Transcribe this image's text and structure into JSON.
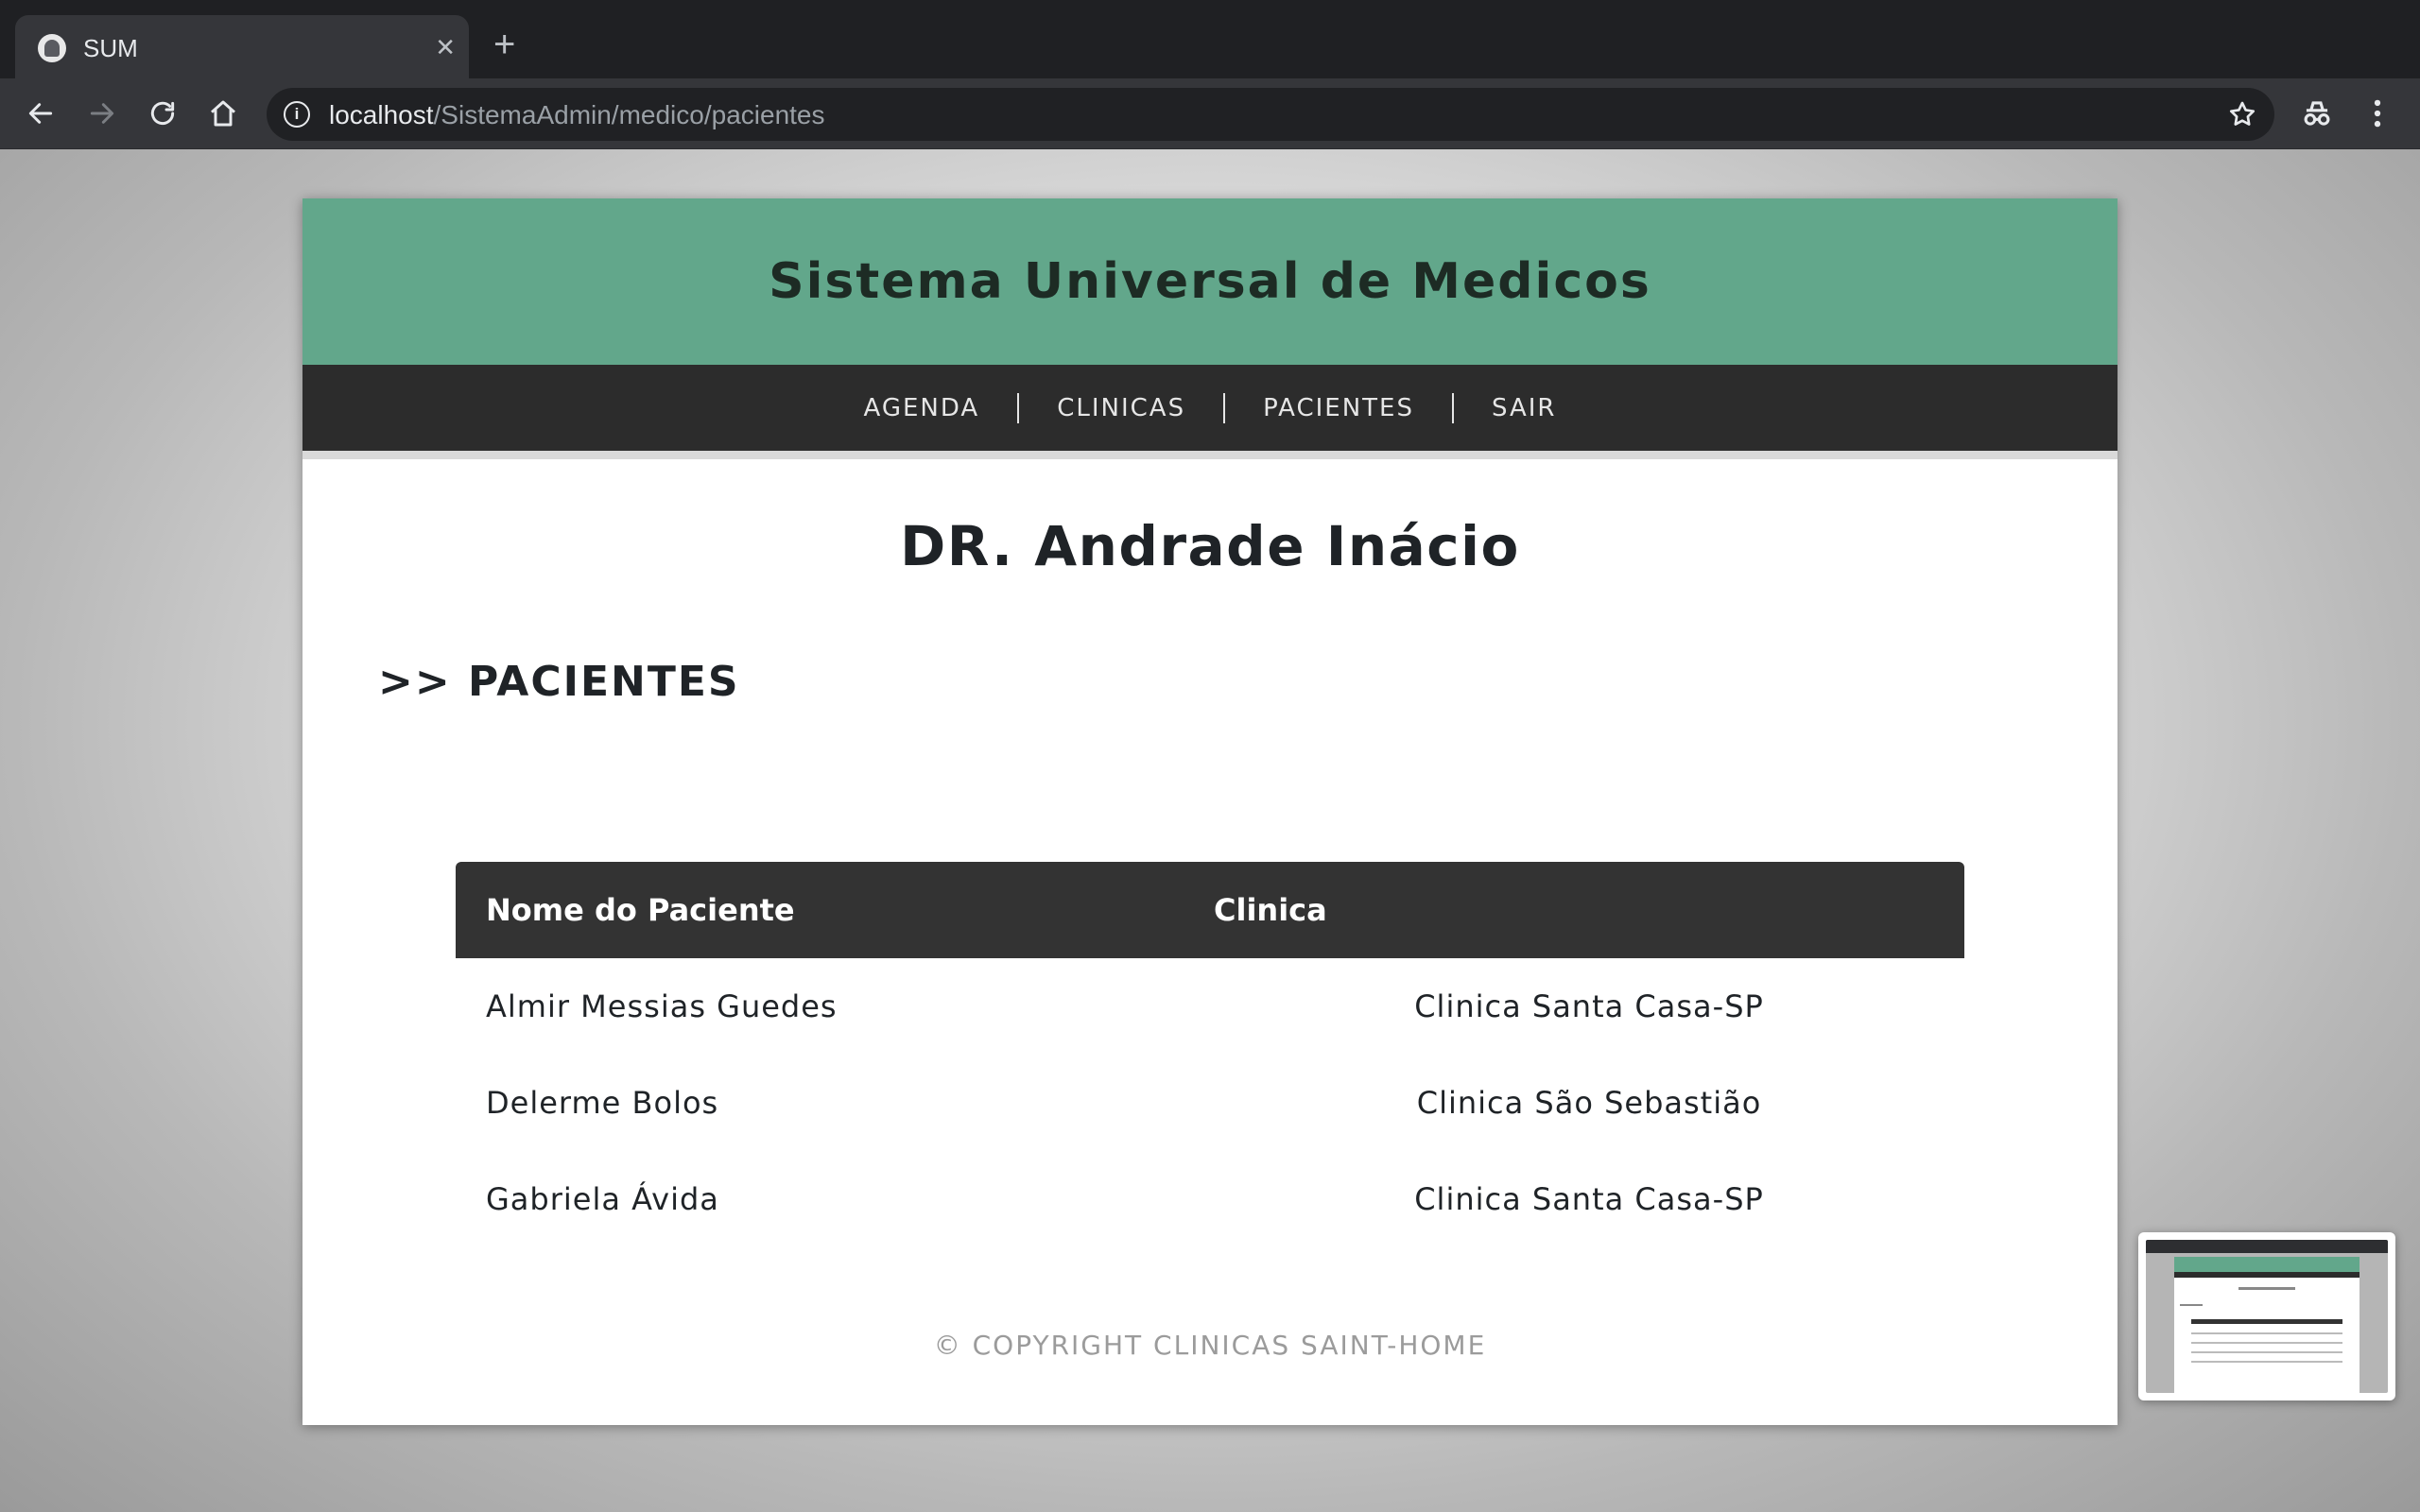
{
  "browser": {
    "tab_title": "SUM",
    "tab_close": "✕",
    "new_tab": "+",
    "url_host": "localhost",
    "url_path": "/SistemaAdmin/medico/pacientes",
    "info_icon": "i"
  },
  "site": {
    "title": "Sistema Universal de Medicos",
    "nav": [
      "AGENDA",
      "CLINICAS",
      "PACIENTES",
      "SAIR"
    ],
    "doctor_name": "DR. Andrade Inácio",
    "section_title": ">> PACIENTES",
    "table": {
      "headers": [
        "Nome do Paciente",
        "Clinica"
      ],
      "rows": [
        {
          "patient": "Almir Messias Guedes",
          "clinic": "Clinica Santa Casa-SP"
        },
        {
          "patient": "Delerme Bolos",
          "clinic": "Clinica São Sebastião"
        },
        {
          "patient": "Gabriela Ávida",
          "clinic": "Clinica Santa Casa-SP"
        }
      ]
    },
    "footer": "© COPYRIGHT CLINICAS SAINT-HOME"
  },
  "colors": {
    "header_green": "#62a78b",
    "nav_dark": "#2c2c2c",
    "table_header": "#333333"
  }
}
